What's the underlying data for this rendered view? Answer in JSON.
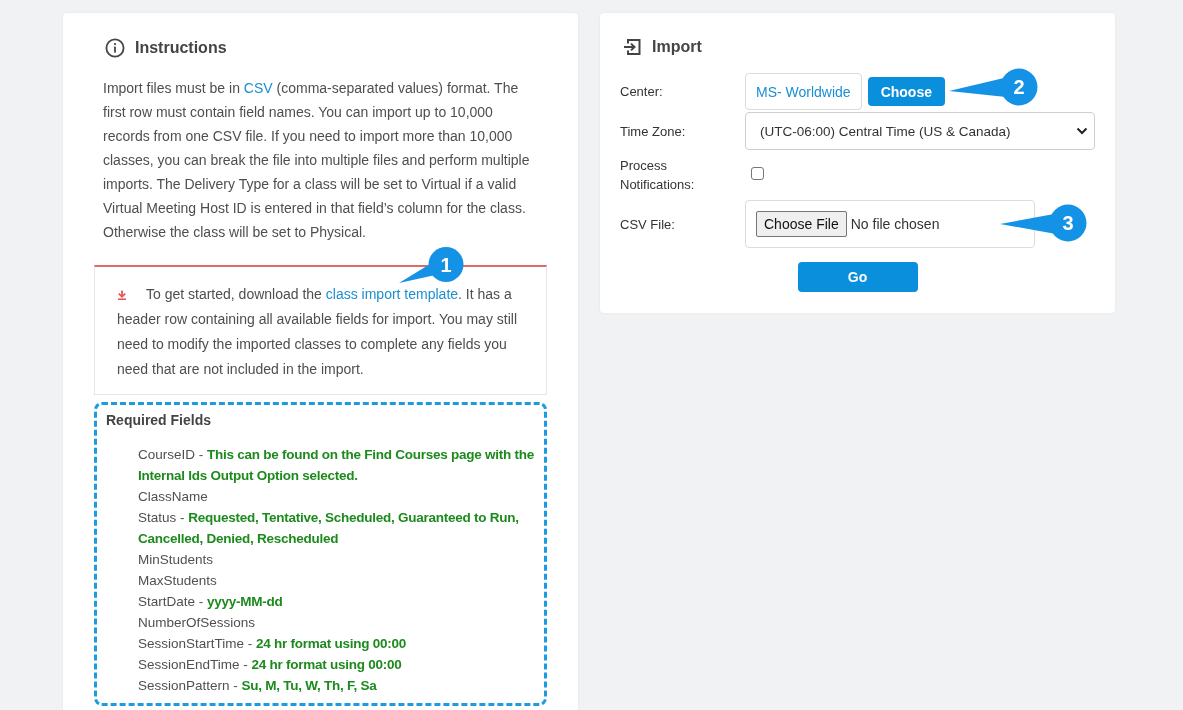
{
  "instructions": {
    "title": "Instructions",
    "body": {
      "text_before": "Import files must be in ",
      "link": "CSV",
      "text_after": " (comma-separated values) format. The first row must contain field names. You can import up to 10,000 records from one CSV file. If you need to import more than 10,000 classes, you can break the file into multiple files and perform multiple imports. The Delivery Type for a class will be set to Virtual if a valid Virtual Meeting Host ID is entered in that field’s column for the class. Otherwise the class will be set to Physical."
    },
    "notice": {
      "text_before": "To get started, download the ",
      "link": "class import template",
      "text_after": ". It has a header row containing all available fields for import. You may still need to modify the imported classes to complete any fields you need that are not included in the import.",
      "callout": "1"
    },
    "required_fields": {
      "title": "Required Fields",
      "items": [
        "CourseID - **This can be found on the Find Courses page with the Internal Ids Output Option selected.**",
        "ClassName",
        "Status - **Requested, Tentative, Scheduled, Guaranteed to Run, Cancelled, Denied, Rescheduled**",
        "MinStudents",
        "MaxStudents",
        "StartDate - **yyyy-MM-dd**",
        "NumberOfSessions",
        "SessionStartTime - **24 hr format using 00:00**",
        "SessionEndTime - **24 hr format using 00:00**",
        "SessionPattern - **Su, M, Tu, W, Th, F, Sa**"
      ]
    }
  },
  "import": {
    "title": "Import",
    "center": {
      "label": "Center:",
      "value": "MS- Worldwide",
      "button": "Choose",
      "callout": "2"
    },
    "time_zone": {
      "label": "Time Zone:",
      "value": "(UTC-06:00) Central Time (US & Canada)"
    },
    "process_notifications": {
      "label": "Process Notifications:",
      "checked": false
    },
    "csv_file": {
      "label": "CSV File:",
      "button": "Choose File",
      "status": "No file chosen",
      "callout": "3"
    },
    "submit": "Go"
  }
}
